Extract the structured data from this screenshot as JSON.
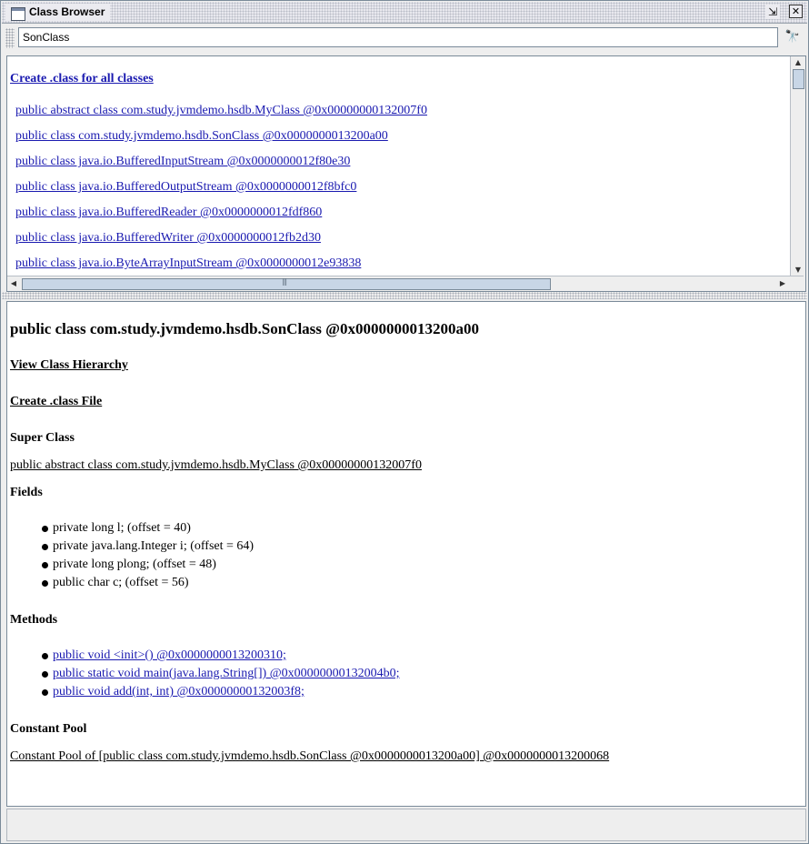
{
  "window": {
    "title": "Class Browser",
    "minimize_glyph": "⇲",
    "close_glyph": "✕"
  },
  "search": {
    "value": "SonClass",
    "find_icon": "binoculars-icon",
    "find_glyph": "🔭"
  },
  "class_list": {
    "create_all_label": "Create .class for all classes",
    "items": [
      "public abstract class com.study.jvmdemo.hsdb.MyClass @0x00000000132007f0",
      "public class com.study.jvmdemo.hsdb.SonClass @0x0000000013200a00",
      "public class java.io.BufferedInputStream @0x0000000012f80e30",
      "public class java.io.BufferedOutputStream @0x0000000012f8bfc0",
      "public class java.io.BufferedReader @0x0000000012fdf860",
      "public class java.io.BufferedWriter @0x0000000012fb2d30",
      "public class java.io.ByteArrayInputStream @0x0000000012e93838"
    ]
  },
  "detail": {
    "heading": "public class com.study.jvmdemo.hsdb.SonClass @0x0000000013200a00",
    "view_hierarchy": "View Class Hierarchy",
    "create_class_file": "Create .class File",
    "super_class_header": "Super Class",
    "super_class": "public abstract class com.study.jvmdemo.hsdb.MyClass @0x00000000132007f0",
    "fields_header": "Fields",
    "fields": [
      "private long l; (offset = 40)",
      "private java.lang.Integer i; (offset = 64)",
      "private long plong; (offset = 48)",
      "public char c; (offset = 56)"
    ],
    "methods_header": "Methods",
    "methods": [
      "public void <init>() @0x0000000013200310;",
      "public static void main(java.lang.String[]) @0x00000000132004b0;",
      "public void add(int, int) @0x00000000132003f8;"
    ],
    "constant_pool_header": "Constant Pool",
    "constant_pool": "Constant Pool of [public class com.study.jvmdemo.hsdb.SonClass @0x0000000013200a00] @0x0000000013200068"
  }
}
